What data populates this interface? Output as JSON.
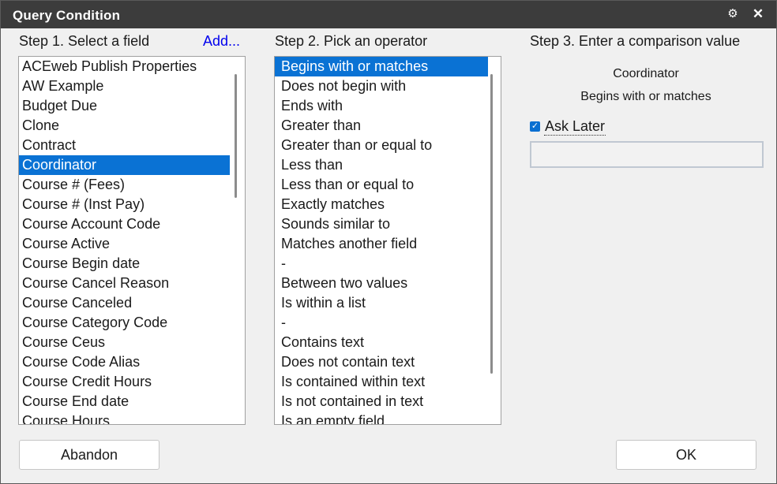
{
  "window": {
    "title": "Query Condition",
    "icons": {
      "settings": "gear-icon",
      "close": "close-icon"
    },
    "close_glyph": "✕",
    "settings_glyph": "⚙"
  },
  "step1": {
    "label": "Step 1. Select a field",
    "add_link": "Add...",
    "fields": [
      "ACEweb Publish Properties",
      "AW Example",
      "Budget Due",
      "Clone",
      "Contract",
      "Coordinator",
      "Course # (Fees)",
      "Course # (Inst Pay)",
      "Course Account Code",
      "Course Active",
      "Course Begin date",
      "Course Cancel Reason",
      "Course Canceled",
      "Course Category Code",
      "Course Ceus",
      "Course Code Alias",
      "Course Credit Hours",
      "Course End date",
      "Course Hours"
    ],
    "selected": "Coordinator"
  },
  "step2": {
    "label": "Step 2. Pick an operator",
    "operators": [
      "Begins with or matches",
      "Does not begin with",
      "Ends with",
      "Greater than",
      "Greater than or equal to",
      "Less than",
      "Less than or equal to",
      "Exactly matches",
      "Sounds similar to",
      "Matches another field",
      "-",
      "Between two values",
      "Is within a list",
      "-",
      "Contains text",
      "Does not contain text",
      "Is contained within text",
      "Is not contained in text",
      "Is an empty field"
    ],
    "selected": "Begins with or matches"
  },
  "step3": {
    "label": "Step 3. Enter a comparison value",
    "field_name": "Coordinator",
    "operator_name": "Begins with or matches",
    "ask_later_label": "Ask Later",
    "ask_later_checked": true,
    "value": ""
  },
  "buttons": {
    "abandon": "Abandon",
    "ok": "OK"
  },
  "colors": {
    "titlebar": "#3c3c3c",
    "selection": "#0a72d4",
    "link": "#0000ee"
  }
}
